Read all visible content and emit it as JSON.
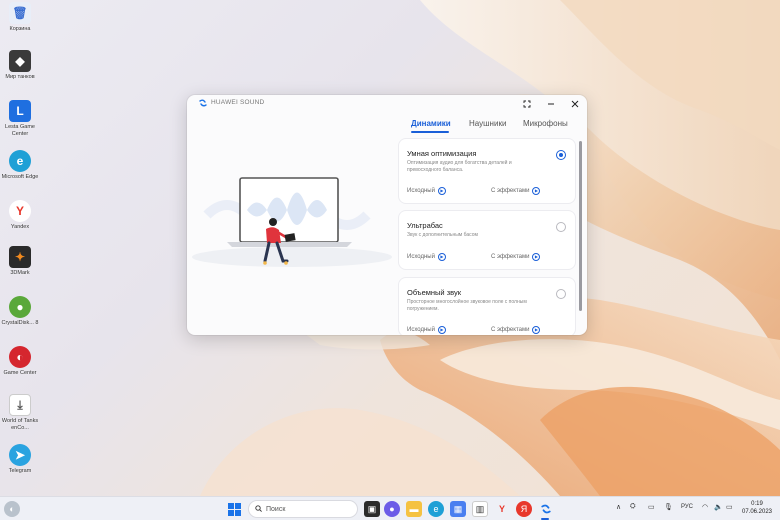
{
  "desktop": {
    "icons": [
      {
        "label": "Корзина",
        "icon": "recycle-bin-icon",
        "color": "#3b6fd1"
      },
      {
        "label": "Мир танков",
        "icon": "tank-game-icon",
        "color": "#3a3a3a"
      },
      {
        "label": "Lesta Game Center",
        "icon": "lesta-icon",
        "color": "#1f6fe0"
      },
      {
        "label": "Microsoft Edge",
        "icon": "edge-icon",
        "color": "#1fa0d6"
      },
      {
        "label": "Yandex",
        "icon": "yandex-icon",
        "color": "#e8382c"
      },
      {
        "label": "3DMark",
        "icon": "3dmark-icon",
        "color": "#2a2a2a"
      },
      {
        "label": "CrystalDisk... 8",
        "icon": "crystaldisk-icon",
        "color": "#5aa83a"
      },
      {
        "label": "Game Center",
        "icon": "game-center-icon",
        "color": "#d5262e"
      },
      {
        "label": "World of Tanks enCo...",
        "icon": "wot-icon",
        "color": "#ffffff"
      },
      {
        "label": "Telegram",
        "icon": "telegram-icon",
        "color": "#2aa3e0"
      }
    ]
  },
  "window": {
    "title": "HUAWEI SOUND",
    "tabs": [
      {
        "label": "Динамики",
        "active": true
      },
      {
        "label": "Наушники",
        "active": false
      },
      {
        "label": "Микрофоны",
        "active": false
      }
    ],
    "cards": [
      {
        "title": "Умная оптимизация",
        "desc": "Оптимизация аудио для богатства деталей и превосходного баланса.",
        "selected": true,
        "original_label": "Исходный",
        "effects_label": "С эффектами"
      },
      {
        "title": "Ультрабас",
        "desc": "Звук с дополнительным басом",
        "selected": false,
        "original_label": "Исходный",
        "effects_label": "С эффектами"
      },
      {
        "title": "Объемный звук",
        "desc": "Просторное многослойное звуковое поле с полным погружением.",
        "selected": false,
        "original_label": "Исходный",
        "effects_label": "С эффектами"
      }
    ]
  },
  "taskbar": {
    "search_placeholder": "Поиск",
    "language": "РУС",
    "time": "0:19",
    "date": "07.06.2023"
  },
  "colors": {
    "accent": "#1a5fd8",
    "window_bg": "#fbfbfc"
  }
}
